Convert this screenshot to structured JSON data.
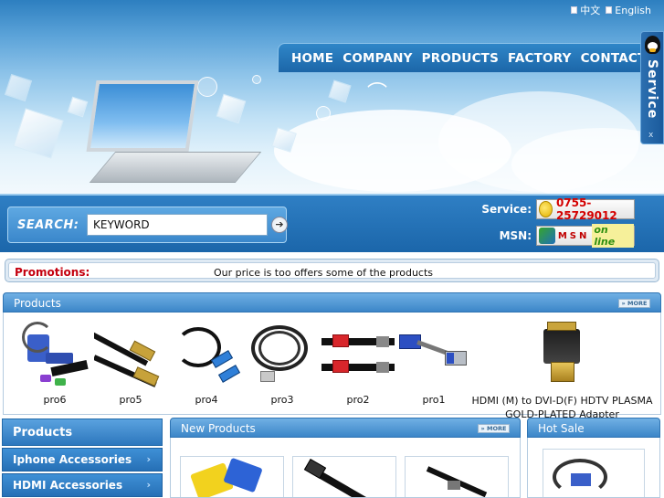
{
  "lang": {
    "chinese_label": "中文",
    "english_label": "English"
  },
  "nav": {
    "items": [
      "HOME",
      "COMPANY",
      "PRODUCTS",
      "FACTORY",
      "CONTACT US"
    ]
  },
  "service_tab": {
    "label": "Service",
    "close": "x"
  },
  "search": {
    "label": "SEARCH:",
    "value": "KEYWORD",
    "go_icon": "arrow-right-icon"
  },
  "contact": {
    "service_label": "Service:",
    "phone": "0755-25729012",
    "msn_label": "MSN:",
    "msn_letters": "MSN",
    "msn_status": "on line"
  },
  "promotions": {
    "label": "Promotions:",
    "text": "Our price is too offers some of the products"
  },
  "products": {
    "title": "Products",
    "more": "MORE",
    "items": [
      {
        "name": "pro6"
      },
      {
        "name": "pro5"
      },
      {
        "name": "pro4"
      },
      {
        "name": "pro3"
      },
      {
        "name": "pro2"
      },
      {
        "name": "pro1"
      }
    ],
    "featured": "HDMI (M) to DVI-D(F) HDTV PLASMA GOLD-PLATED Adapter"
  },
  "sidebar": {
    "title": "Products",
    "items": [
      {
        "label": "Iphone Accessories"
      },
      {
        "label": "HDMI Accessories"
      }
    ]
  },
  "new_products": {
    "title": "New Products",
    "more": "MORE"
  },
  "hot_sale": {
    "title": "Hot Sale"
  },
  "colors": {
    "nav_blue": "#1c66a8",
    "promo_red": "#c4000f",
    "phone_red": "#d40000"
  }
}
